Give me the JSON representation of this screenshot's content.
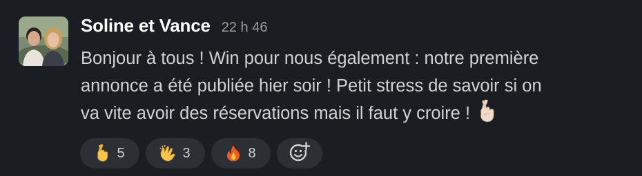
{
  "message": {
    "author": "Soline et Vance",
    "timestamp": "22 h 46",
    "avatar_icon": "couple-photo-avatar",
    "lines": [
      "Bonjour à tous ! Win pour nous également : notre première",
      "annonce a été publiée hier soir ! Petit stress de savoir si on",
      "va vite avoir des réservations mais il faut y croire !"
    ],
    "inline_emoji": "crossed-fingers-icon"
  },
  "reactions": [
    {
      "icon": "crossed-fingers-icon",
      "count": "5"
    },
    {
      "icon": "clapping-hands-icon",
      "count": "3"
    },
    {
      "icon": "fire-icon",
      "count": "8"
    }
  ],
  "add_reaction_icon": "add-reaction-icon",
  "colors": {
    "background": "#1a1d21",
    "text": "#d1d2d3",
    "author": "#ffffff",
    "timestamp": "#9a9b9d",
    "pill": "#2c2f33"
  }
}
